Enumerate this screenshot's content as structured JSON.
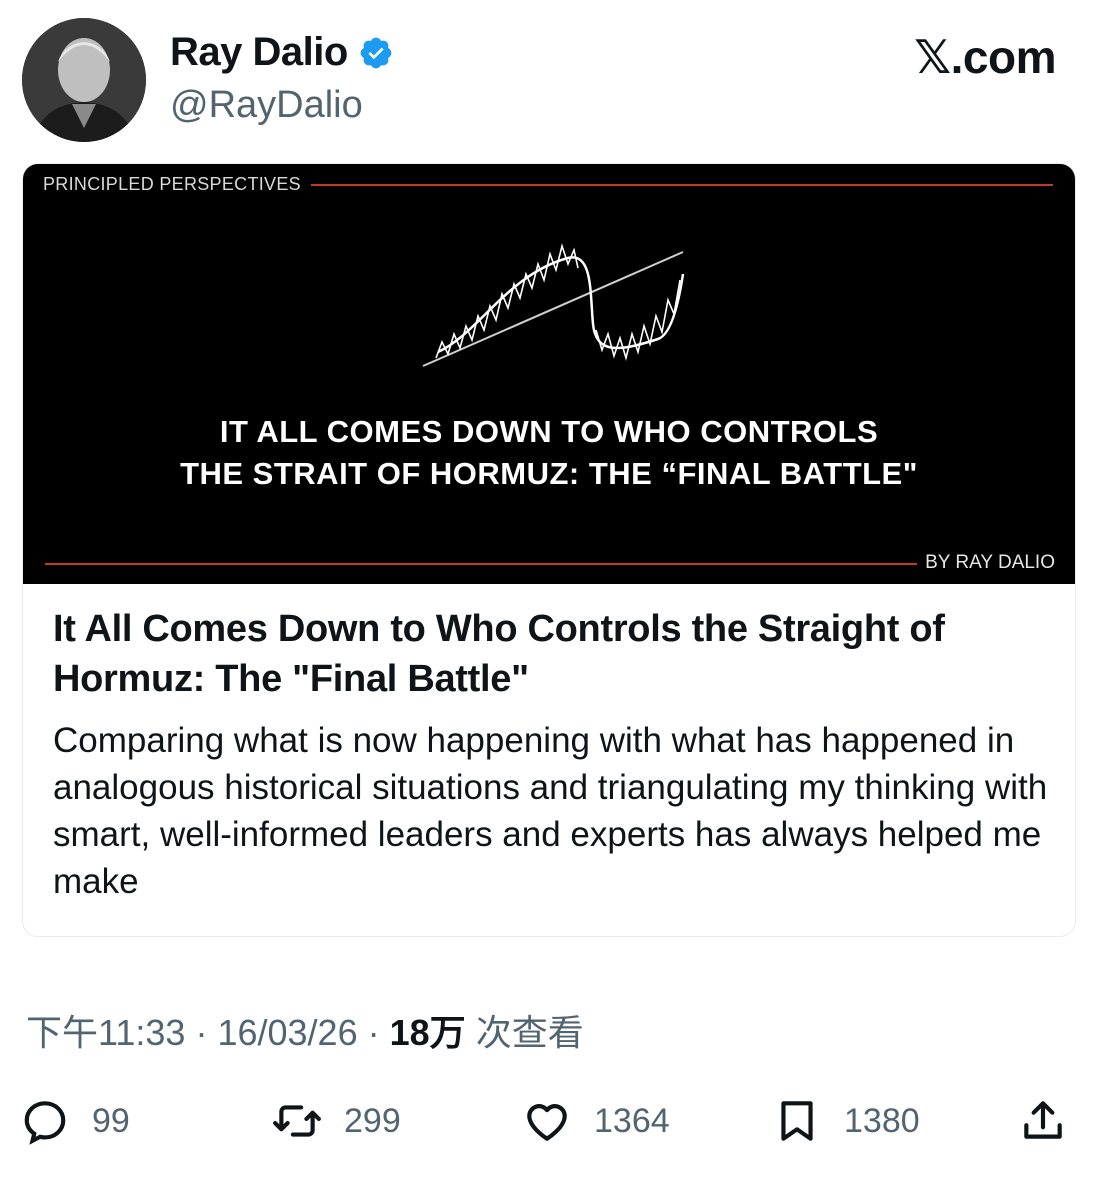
{
  "brand": "𝕏.com",
  "author": {
    "name": "Ray Dalio",
    "handle": "@RayDalio",
    "verified": true
  },
  "card": {
    "image": {
      "series_label": "PRINCIPLED PERSPECTIVES",
      "headline_line1": "IT ALL COMES DOWN TO WHO CONTROLS",
      "headline_line2": "THE STRAIT OF HORMUZ: THE “FINAL BATTLE\"",
      "byline": "BY RAY DALIO"
    },
    "title": "It All Comes Down to Who Controls the Straight of Hormuz: The \"Final Battle\"",
    "description": "Comparing what is now happening with what has happened in analogous historical situations and triangulating my thinking with smart, well-informed leaders and experts has always helped me make"
  },
  "meta": {
    "time": "下午11:33",
    "date": "16/03/26",
    "views": "18万",
    "views_suffix": "次查看",
    "sep": "·"
  },
  "actions": {
    "replies": "99",
    "reposts": "299",
    "likes": "1364",
    "bookmarks": "1380"
  },
  "colors": {
    "accent_red": "#c0392b",
    "verified_blue": "#1d9bf0",
    "muted": "#536471"
  }
}
